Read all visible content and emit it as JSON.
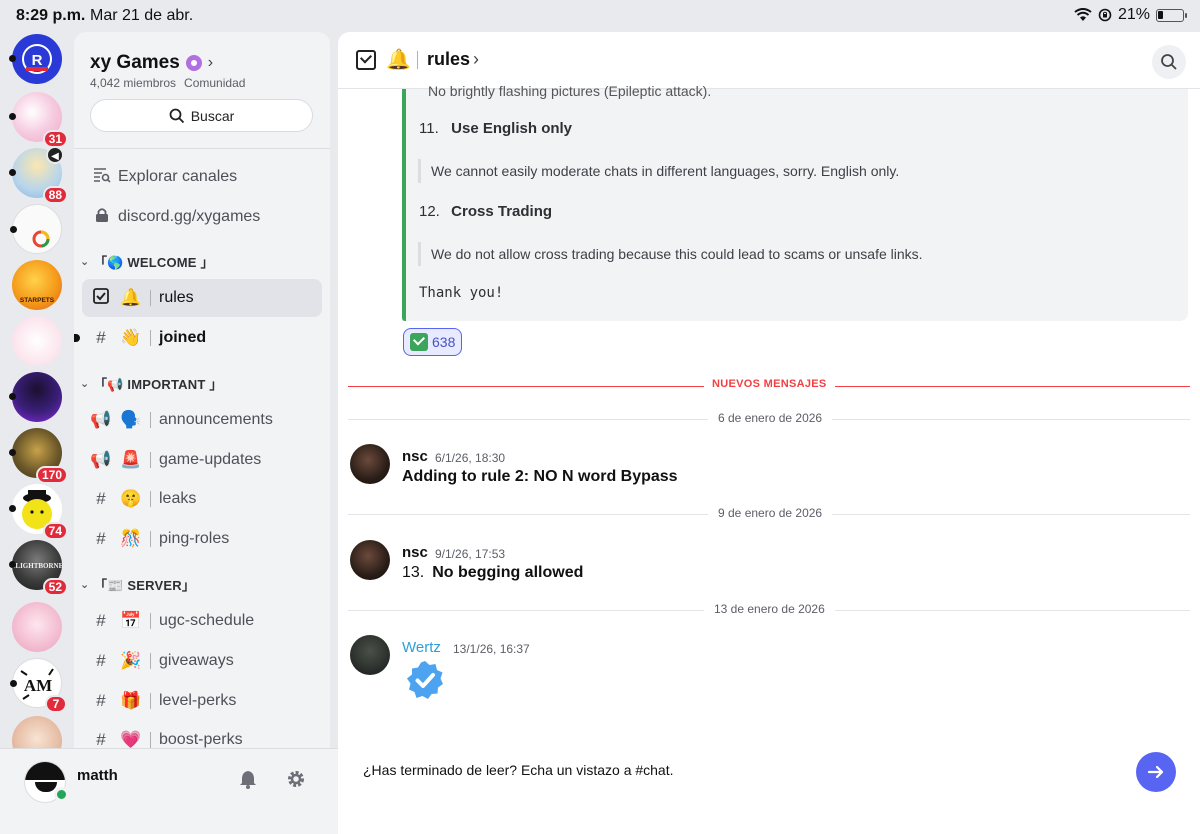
{
  "status_bar": {
    "time": "8:29 p.m.",
    "date": "Mar 21 de abr.",
    "battery": "21%",
    "battery_level": 0.21
  },
  "server_rail": {
    "servers": [
      {
        "name": "CR channel",
        "badge": ""
      },
      {
        "name": "pink server",
        "badge": "31"
      },
      {
        "name": "anime server",
        "badge": "88"
      },
      {
        "name": "white server",
        "badge": ""
      },
      {
        "name": "Starpets",
        "badge": ""
      },
      {
        "name": "bunny server",
        "badge": ""
      },
      {
        "name": "purple server",
        "badge": ""
      },
      {
        "name": "game server",
        "badge": "170"
      },
      {
        "name": "yellow hat server",
        "badge": "74"
      },
      {
        "name": "Blightborne",
        "badge": "52"
      },
      {
        "name": "pink doll server",
        "badge": ""
      },
      {
        "name": "AM server",
        "badge": "7"
      },
      {
        "name": "anime duo server",
        "badge": ""
      }
    ]
  },
  "server": {
    "name": "xy Games",
    "members": "4,042 miembros",
    "type": "Comunidad",
    "search_label": "Buscar",
    "explore_label": "Explorar canales",
    "invite_label": "discord.gg/xygames"
  },
  "categories": [
    {
      "label": "「🌎 WELCOME 」",
      "channels": [
        {
          "icon": "rules-check-icon",
          "emoji": "🔔",
          "name": "rules",
          "selected": true
        },
        {
          "icon": "hash-icon",
          "emoji": "👋",
          "name": "joined",
          "unread": true
        }
      ]
    },
    {
      "label": "「📢 IMPORTANT 」",
      "channels": [
        {
          "icon": "announcement-icon",
          "emoji": "🗣️",
          "name": "announcements"
        },
        {
          "icon": "announcement-icon",
          "emoji": "🚨",
          "name": "game-updates"
        },
        {
          "icon": "hash-icon",
          "emoji": "🤫",
          "name": "leaks"
        },
        {
          "icon": "hash-icon",
          "emoji": "🎊",
          "name": "ping-roles"
        }
      ]
    },
    {
      "label": "「📰 SERVER」",
      "channels": [
        {
          "icon": "hash-icon",
          "emoji": "📅",
          "name": "ugc-schedule"
        },
        {
          "icon": "hash-icon",
          "emoji": "🎉",
          "name": "giveaways"
        },
        {
          "icon": "hash-icon",
          "emoji": "🎁",
          "name": "level-perks"
        },
        {
          "icon": "hash-icon",
          "emoji": "💗",
          "name": "boost-perks"
        }
      ]
    }
  ],
  "user": {
    "name": "matth",
    "status_color": "#23a55a"
  },
  "channel_header": {
    "title": "rules",
    "emoji": "🔔"
  },
  "embed": {
    "cut_text": "No brightly flashing pictures (Epileptic attack).",
    "rules": [
      {
        "num": "11.",
        "title": "Use English only",
        "body": "We cannot easily moderate  chats in different languages, sorry. English only."
      },
      {
        "num": "12.",
        "title": "Cross Trading",
        "body": "We do not allow cross trading because this could lead to scams or unsafe links."
      }
    ],
    "closing": "Thank  you!",
    "accent_color": "#3ba55c"
  },
  "reaction": {
    "emoji": "✅",
    "count": "638"
  },
  "new_messages_label": "NUEVOS MENSAJES",
  "messages": [
    {
      "date": "6 de enero de 2026",
      "author": "nsc",
      "time": "6/1/26, 18:30",
      "number": "",
      "text": "Adding to rule 2: NO N word Bypass"
    },
    {
      "date": "9 de enero de 2026",
      "author": "nsc",
      "time": "9/1/26, 17:53",
      "number": "13.",
      "text": "No begging allowed"
    },
    {
      "date": "13 de enero de 2026",
      "author": "Wertz",
      "time": "13/1/26, 16:37",
      "number": "",
      "text": ""
    }
  ],
  "composer": {
    "text": "¿Has terminado de leer? Echa un vistazo a #chat.",
    "send_color": "#5865f2"
  },
  "colors": {
    "new_messages": "#f23f43",
    "brand": "#5865f2",
    "author_link": "#2f9fd8"
  }
}
